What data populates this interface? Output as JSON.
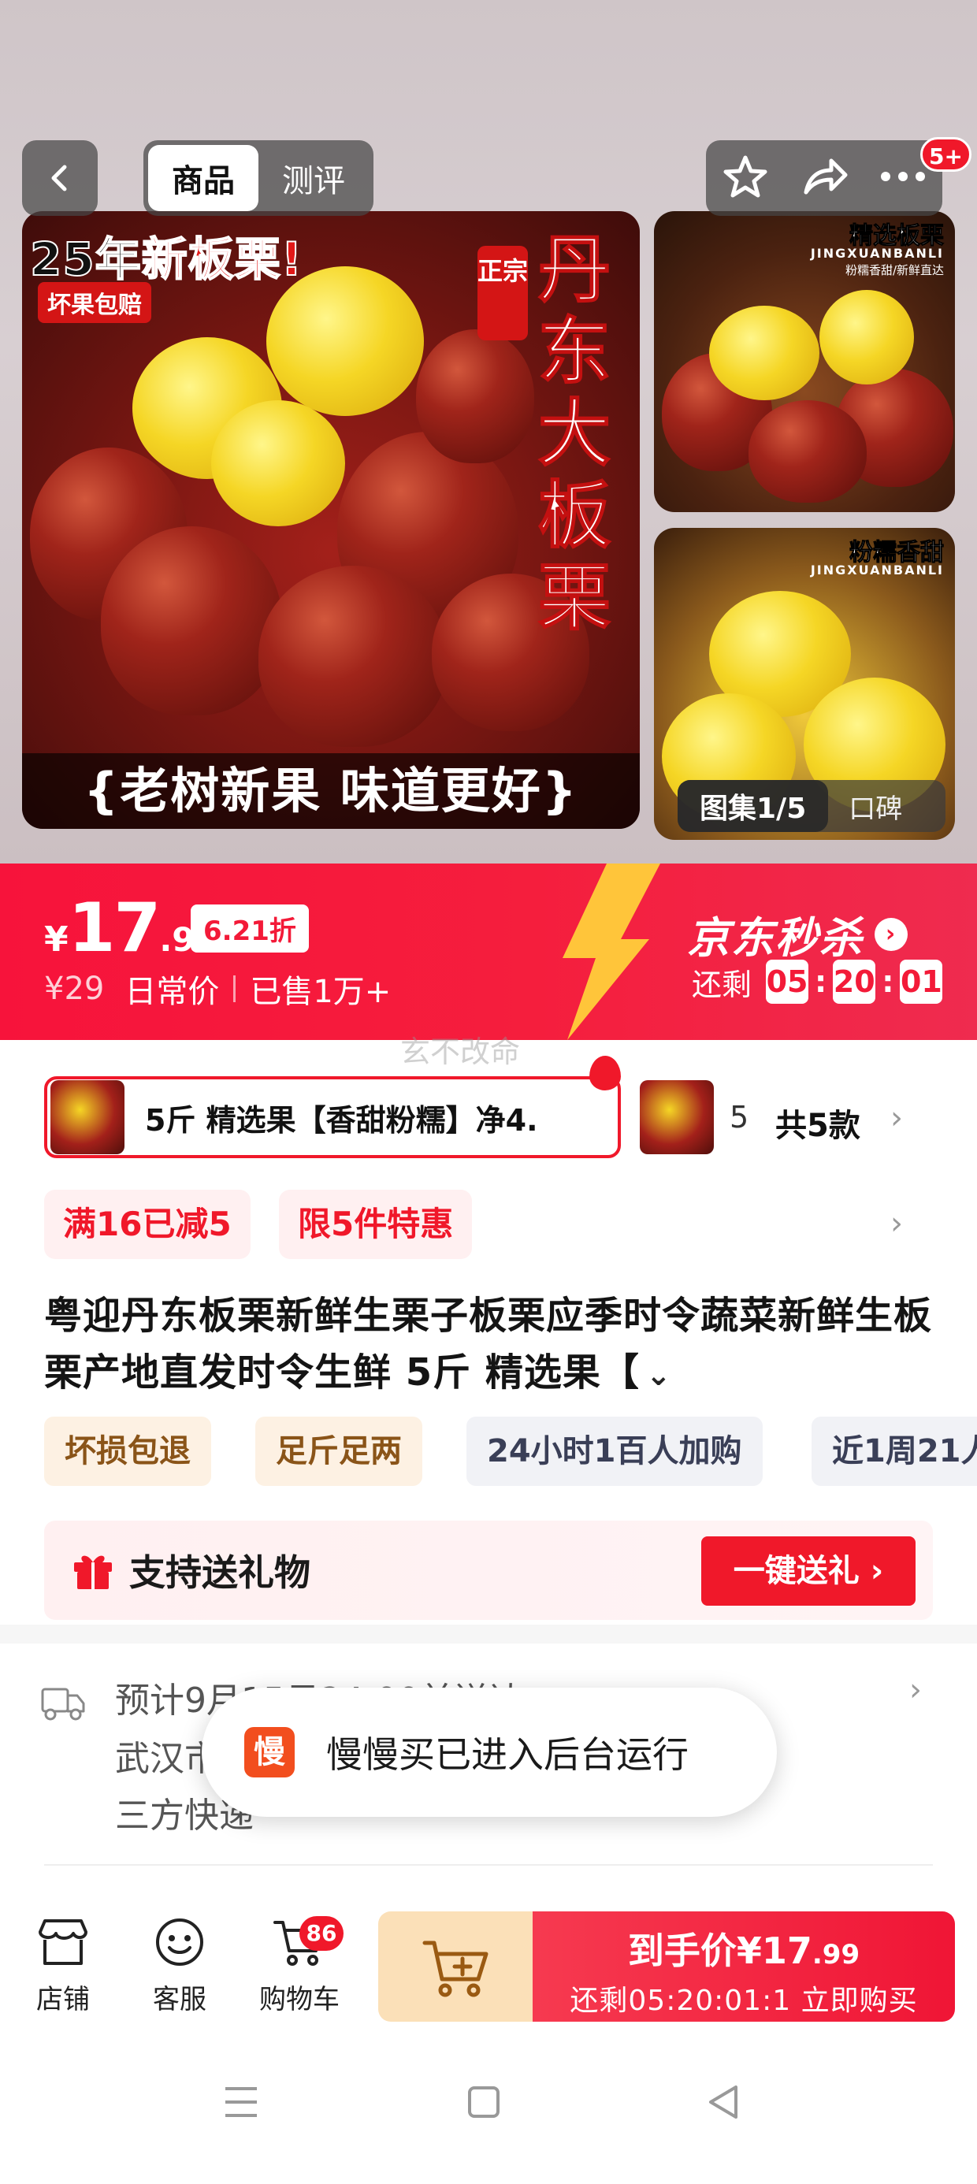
{
  "header": {
    "tabs": [
      {
        "label": "商品",
        "active": true
      },
      {
        "label": "测评",
        "active": false
      }
    ],
    "more_badge": "5+"
  },
  "gallery": {
    "main": {
      "headline_prefix": "25年",
      "headline_highlight": "新板栗!",
      "tag": "坏果包赔",
      "stamp": "正宗",
      "vertical_title": "丹东大板栗",
      "slogan": "{老树新果 味道更好}"
    },
    "side1": {
      "title": "精选板栗",
      "en": "JINGXUANBANLI",
      "sub": "粉糯香甜/新鲜直达"
    },
    "side2": {
      "title": "粉糯香甜",
      "en": "JINGXUANBANLI"
    },
    "counter": "图集1/5",
    "reviews_label": "口碑"
  },
  "price": {
    "currency": "¥",
    "integer": "17",
    "decimal": ".99",
    "discount": "6.21折",
    "daily_price": "¥29",
    "daily_label": "日常价",
    "sold": "已售1万+",
    "seckill_label": "京东秒杀",
    "countdown_label": "还剩",
    "countdown": [
      "05",
      "20",
      "01"
    ]
  },
  "watermark": "玄不改命",
  "variant": {
    "selected": "5斤 精选果【香甜粉糯】净4.",
    "other_prefix": "5",
    "count_label": "共5款"
  },
  "promotions": [
    "满16已减5",
    "限5件特惠"
  ],
  "title": {
    "text": "粤迎丹东板栗新鲜生栗子板栗应季时令蔬菜新鲜生板栗产地直发时令生鲜 5斤 精选果【"
  },
  "features": [
    "坏损包退",
    "足斤足两",
    "24小时1百人加购",
    "近1周21人"
  ],
  "gift": {
    "label": "支持送礼物",
    "button": "一键送礼 ›"
  },
  "delivery": {
    "line1": "预计9月15日24:00前送达",
    "line2": "武汉市",
    "line3": "三方快递"
  },
  "toast": {
    "icon_text": "慢",
    "text": "慢慢买已进入后台运行"
  },
  "bottom_bar": {
    "shop_label": "店铺",
    "service_label": "客服",
    "cart_label": "购物车",
    "cart_badge": "86",
    "buy_price_label": "到手价¥17",
    "buy_price_decimal": ".99",
    "buy_sub": "还剩05:20:01:1  立即购买"
  },
  "colors": {
    "brand_red": "#f0182a",
    "price_banner": "#f51e3d",
    "add_cart_bg": "#fbe0b8"
  }
}
